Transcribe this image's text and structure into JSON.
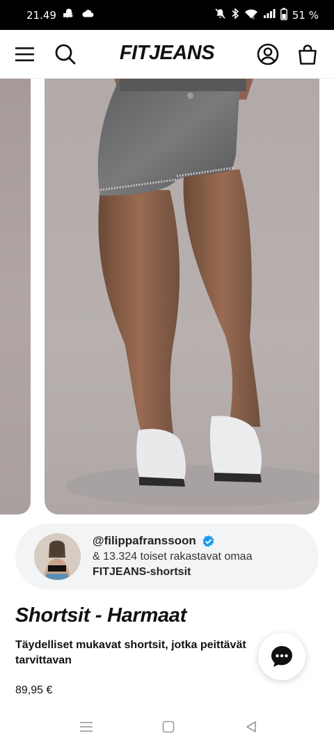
{
  "status_bar": {
    "time": "21.49",
    "battery": "51 %",
    "icons": [
      "snapchat-icon",
      "cloud-icon",
      "mute-icon",
      "bluetooth-icon",
      "wifi-icon",
      "signal-icon",
      "battery-icon"
    ]
  },
  "header": {
    "logo": "FITJEANS",
    "icons": [
      "menu-icon",
      "search-icon",
      "account-icon",
      "bag-icon"
    ]
  },
  "influencer": {
    "handle": "@filippafranssoon",
    "line2": "& 13.324 toiset rakastavat omaa",
    "line3": "FITJEANS-shortsit",
    "verified_color": "#1d9bf0"
  },
  "product": {
    "title": "Shortsit - Harmaat",
    "description": "Täydelliset mukavat shortsit, jotka peittävät tarvittavan",
    "price": "89,95 €"
  },
  "chat": {
    "icon": "chat-bubble-icon"
  },
  "nav": {
    "icons": [
      "recents-icon",
      "home-icon",
      "back-icon"
    ]
  }
}
